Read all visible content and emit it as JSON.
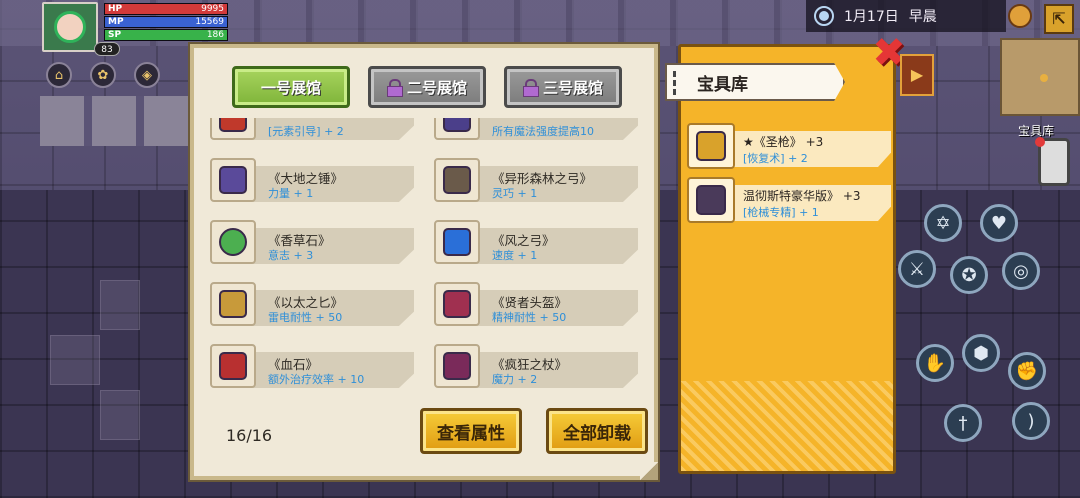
{
  "hud": {
    "hp_label": "HP",
    "hp_value": "9995",
    "mp_label": "MP",
    "mp_value": "15569",
    "sp_label": "SP",
    "sp_value": "186",
    "level": "83"
  },
  "date": {
    "day": "1月17日",
    "period": "早晨"
  },
  "minimap_label": "宝具库",
  "museum": {
    "tabs": [
      {
        "label": "一号展馆",
        "state": "active"
      },
      {
        "label": "二号展馆",
        "state": "locked"
      },
      {
        "label": "三号展馆",
        "state": "locked"
      }
    ],
    "items": [
      {
        "name": "",
        "stat": "[元素引导] + 2",
        "icon": "wand-icon",
        "color": "#c0392b"
      },
      {
        "name": "",
        "stat": "所有魔法强度提高10",
        "icon": "staff-icon",
        "color": "#4b3f8a"
      },
      {
        "name": "《大地之锤》",
        "stat": "力量 + 1",
        "icon": "hammer-icon",
        "color": "#5a4a9a"
      },
      {
        "name": "《异形森林之弓》",
        "stat": "灵巧 + 1",
        "icon": "bow-icon",
        "color": "#6a5a4a"
      },
      {
        "name": "《香草石》",
        "stat": "意志 + 3",
        "icon": "stone-icon",
        "color": "#4caf50"
      },
      {
        "name": "《风之弓》",
        "stat": "速度 + 1",
        "icon": "wind-bow-icon",
        "color": "#2a6fd8"
      },
      {
        "name": "《以太之匕》",
        "stat": "雷电耐性 + 50",
        "icon": "dagger-icon",
        "color": "#c89a3a"
      },
      {
        "name": "《贤者头盔》",
        "stat": "精神耐性 + 50",
        "icon": "helmet-icon",
        "color": "#a03050"
      },
      {
        "name": "《血石》",
        "stat": "额外治疗效率 + 10",
        "icon": "blood-stone-icon",
        "color": "#b83030"
      },
      {
        "name": "《疯狂之杖》",
        "stat": "魔力 + 2",
        "icon": "mace-icon",
        "color": "#7a2a5a"
      }
    ],
    "count": "16/16",
    "view_button": "查看属性",
    "unload_button": "全部卸载"
  },
  "vault": {
    "title": "宝具库",
    "items": [
      {
        "name": "★《圣枪》 +3",
        "stat": "[恢复术] + 2",
        "icon": "holy-spear-icon",
        "color": "#d9a22b"
      },
      {
        "name": "温彻斯特豪华版》 +3",
        "stat": "[枪械专精] + 1",
        "icon": "rifle-icon",
        "color": "#4a3a5a"
      }
    ]
  },
  "side_tab_icon": "play-icon"
}
